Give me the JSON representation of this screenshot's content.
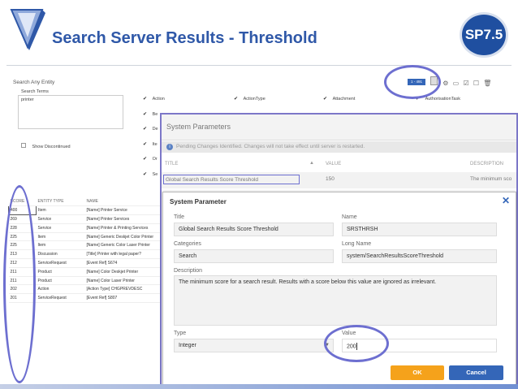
{
  "slide": {
    "title": "Search Server Results - Threshold",
    "badge": "SP7.5",
    "colors": {
      "title": "#2f58a8",
      "badge": "#1f4fa0",
      "highlight": "#6d6fd0",
      "ok": "#f5a21b",
      "cancel": "#3466b8"
    }
  },
  "search": {
    "heading": "Search Any Entity",
    "terms_label": "Search Terms",
    "terms_value": "printer",
    "show_discontinued": "Show Discontinued",
    "counter": "1 - 491"
  },
  "filters": [
    "Action",
    "ActionType",
    "Attachment",
    "AuthorisationTask"
  ],
  "filters_partial": [
    "Be",
    "De",
    "Ite",
    "Or",
    "Se"
  ],
  "results": {
    "headers": [
      "SCORE",
      "ENTITY TYPE",
      "NAME"
    ],
    "rows": [
      [
        "400",
        "Item",
        "[Name] Printer Service"
      ],
      [
        "269",
        "Service",
        "[Name] Printer Services"
      ],
      [
        "228",
        "Service",
        "[Name] Printer & Printing Services"
      ],
      [
        "225",
        "Item",
        "[Name] Generic Deskjet Color Printer"
      ],
      [
        "225",
        "Item",
        "[Name] Generic Color Laser Printer"
      ],
      [
        "213",
        "Discussion",
        "[Title] Printer with legal paper?"
      ],
      [
        "212",
        "ServiceRequest",
        "[Event Ref] S674"
      ],
      [
        "211",
        "Product",
        "[Name] Color Deskjet Printer"
      ],
      [
        "211",
        "Product",
        "[Name] Color Laser Printer"
      ],
      [
        "202",
        "Action",
        "[Action Type] CHGPREVDESC"
      ],
      [
        "201",
        "ServiceRequest",
        "[Event Ref] S807"
      ]
    ]
  },
  "system_params": {
    "header": "System Parameters",
    "warning": "Pending Changes Identified. Changes will not take effect until server is restarted.",
    "columns": [
      "TITLE",
      "VALUE",
      "DESCRIPTION"
    ],
    "row": {
      "title": "Global Search Results Score Threshold",
      "value": "150",
      "description": "The minimum sco"
    }
  },
  "dialog": {
    "header": "System Parameter",
    "title_label": "Title",
    "title_value": "Global Search Results Score Threshold",
    "name_label": "Name",
    "name_value": "SRSTHRSH",
    "categories_label": "Categories",
    "categories_value": "Search",
    "long_name_label": "Long Name",
    "long_name_value": "system/SearchResultsScoreThreshold",
    "description_label": "Description",
    "description_value": "The minimum score for a search result. Results with a score below this value are ignored as irrelevant.",
    "type_label": "Type",
    "type_value": "Integer",
    "value_label": "Value",
    "value_value": "200",
    "ok": "OK",
    "cancel": "Cancel"
  }
}
